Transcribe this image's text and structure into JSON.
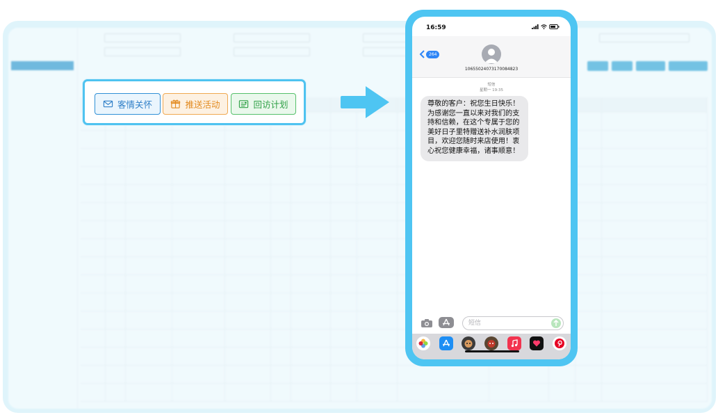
{
  "card": {
    "buttons": [
      {
        "label": "客情关怀",
        "icon": "envelope-icon"
      },
      {
        "label": "推送活动",
        "icon": "gift-icon"
      },
      {
        "label": "回访计划",
        "icon": "calendar-card-icon"
      }
    ]
  },
  "phone": {
    "time": "16:59",
    "back_badge": "264",
    "sender_number": "10655024073170084823",
    "sms_label": "短信",
    "datetime": "星期一 19:35",
    "message": "尊敬的客户：祝您生日快乐！为感谢您一直以来对我们的支持和信赖，在这个专属于您的美好日子里特赠送补水润肤项目，欢迎您随时来店使用！衷心祝您健康幸福，诸事顺意！",
    "input_placeholder": "短信"
  },
  "colors": {
    "accent": "#4ec5f2",
    "care": "#2f7fc8",
    "promo": "#e28a1f",
    "revisit": "#2fa046"
  }
}
